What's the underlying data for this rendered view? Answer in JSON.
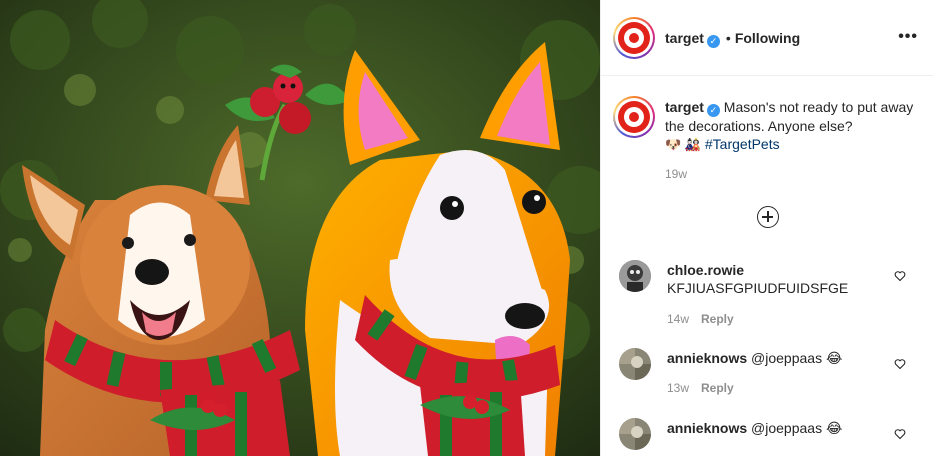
{
  "post": {
    "account": "target",
    "verified_mark": "✓",
    "separator": "•",
    "follow_status": "Following",
    "more_glyph": "•••",
    "caption_text": "Mason's not ready to put away the decorations. Anyone else?",
    "caption_emojis": "🐶 🎎",
    "caption_hashtag": "#TargetPets",
    "time_ago": "19w",
    "icons": {
      "avatar": "target-logo-icon",
      "load_more": "plus-circle-icon",
      "like": "heart-icon",
      "more": "more-options-icon"
    }
  },
  "comments": [
    {
      "username": "chloe.rowie",
      "text": "KFJIUASFGPIUDFUIDSFGE",
      "age": "14w",
      "reply_label": "Reply"
    },
    {
      "username": "annieknows",
      "text": "@joeppaas 😂",
      "age": "13w",
      "reply_label": "Reply"
    },
    {
      "username": "annieknows",
      "text": "@joeppaas 😂",
      "age": "",
      "reply_label": ""
    }
  ],
  "colors": {
    "brand_red": "#e2231a",
    "link_blue": "#00376b",
    "verified_blue": "#3897f0",
    "muted_text": "#8e8e8e"
  }
}
